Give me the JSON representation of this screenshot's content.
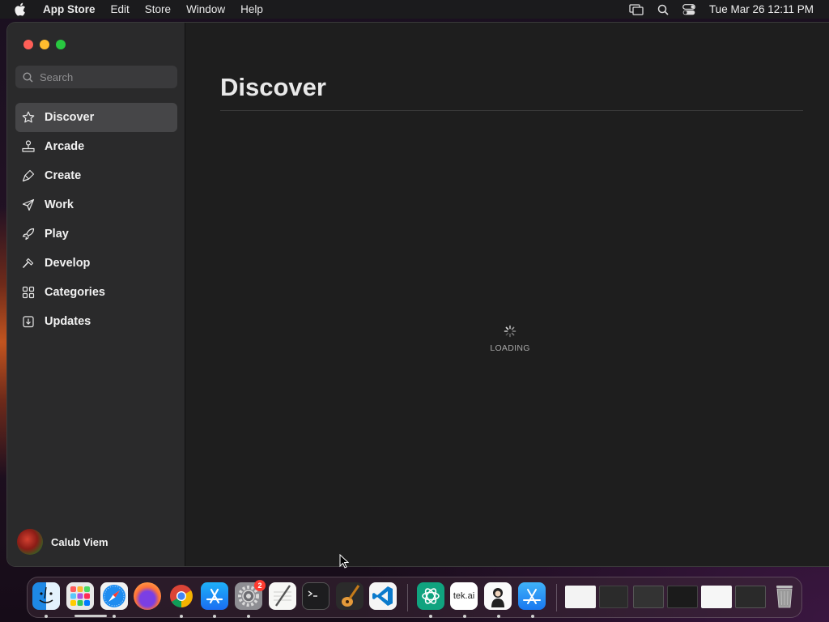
{
  "menubar": {
    "app_name": "App Store",
    "items": [
      "Edit",
      "Store",
      "Window",
      "Help"
    ],
    "clock": "Tue Mar 26  12:11 PM"
  },
  "sidebar": {
    "search_placeholder": "Search",
    "items": [
      {
        "label": "Discover",
        "icon": "star-icon",
        "active": true
      },
      {
        "label": "Arcade",
        "icon": "joystick-icon"
      },
      {
        "label": "Create",
        "icon": "brush-icon"
      },
      {
        "label": "Work",
        "icon": "paper-plane-icon"
      },
      {
        "label": "Play",
        "icon": "rocket-icon"
      },
      {
        "label": "Develop",
        "icon": "hammer-icon"
      },
      {
        "label": "Categories",
        "icon": "grid-icon"
      },
      {
        "label": "Updates",
        "icon": "download-icon"
      }
    ],
    "account_name": "Calub Viem"
  },
  "main": {
    "title": "Discover",
    "loading_text": "LOADING"
  },
  "dock": {
    "apps": [
      {
        "name": "Finder",
        "icon": "finder-icon"
      },
      {
        "name": "Launchpad",
        "icon": "launchpad-icon"
      },
      {
        "name": "Safari",
        "icon": "safari-icon"
      },
      {
        "name": "Firefox",
        "icon": "firefox-icon"
      },
      {
        "name": "Chrome",
        "icon": "chrome-icon"
      },
      {
        "name": "App Store",
        "icon": "app-store-icon"
      },
      {
        "name": "System Settings",
        "icon": "gear-icon",
        "badge": "2"
      },
      {
        "name": "TextEdit",
        "icon": "pen-icon"
      },
      {
        "name": "Terminal",
        "icon": "terminal-icon"
      },
      {
        "name": "GarageBand",
        "icon": "guitar-icon"
      },
      {
        "name": "VS Code",
        "icon": "vscode-icon"
      },
      {
        "name": "ChatGPT",
        "icon": "chatgpt-icon"
      },
      {
        "name": "Tekai",
        "icon": "tekai-icon",
        "label": "tek.ai"
      },
      {
        "name": "Character",
        "icon": "character-icon"
      },
      {
        "name": "App Store Helper",
        "icon": "xcode-icon"
      },
      {
        "name": "Trash",
        "icon": "trash-icon"
      }
    ]
  },
  "colors": {
    "traffic_close": "#fe5f57",
    "traffic_min": "#febc2e",
    "traffic_max": "#28c840",
    "sidebar_bg": "#2a2a2b",
    "main_bg": "#1e1e1e",
    "active_item": "#464648"
  }
}
